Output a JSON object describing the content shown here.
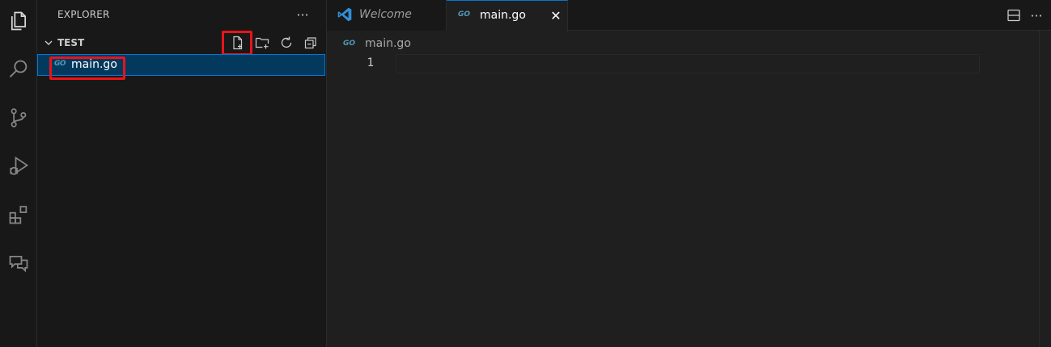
{
  "explorer": {
    "title": "EXPLORER",
    "more": "···",
    "folder": "TEST",
    "files": [
      {
        "icon": "GO",
        "name": "main.go"
      }
    ]
  },
  "tabs": [
    {
      "label": "Welcome",
      "icon": "vscode-icon"
    },
    {
      "label": "main.go",
      "icon": "GO",
      "close": "✕"
    }
  ],
  "editor": {
    "more": "···",
    "breadcrumb": {
      "icon": "GO",
      "label": "main.go"
    },
    "line_numbers": [
      "1"
    ]
  },
  "colors": {
    "accent": "#0078d4",
    "selection": "#04395e",
    "highlight": "#e8141a",
    "go_blue": "#519aba"
  }
}
